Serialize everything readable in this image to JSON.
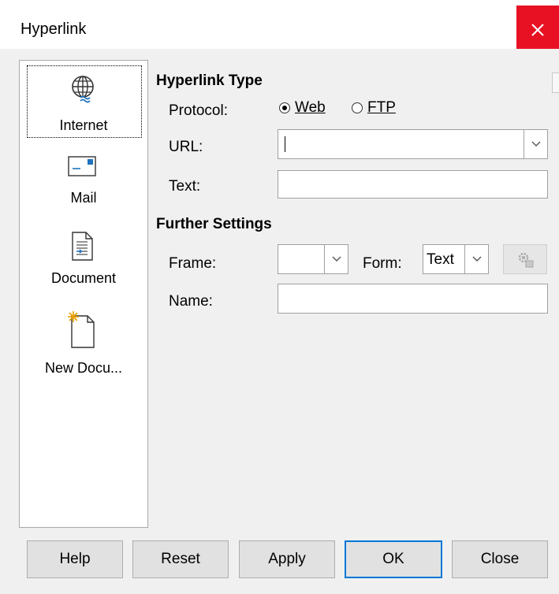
{
  "window": {
    "title": "Hyperlink"
  },
  "sidebar": {
    "items": [
      {
        "label": "Internet",
        "icon": "globe-link-icon",
        "selected": true
      },
      {
        "label": "Mail",
        "icon": "envelope-icon",
        "selected": false
      },
      {
        "label": "Document",
        "icon": "document-icon",
        "selected": false
      },
      {
        "label": "New Docu...",
        "icon": "new-document-icon",
        "selected": false
      }
    ]
  },
  "hyperlink_type": {
    "heading": "Hyperlink Type",
    "protocol_label": "Protocol:",
    "protocol_options": [
      {
        "label": "Web",
        "checked": true
      },
      {
        "label": "FTP",
        "checked": false
      }
    ],
    "url_label": "URL:",
    "url_value": "",
    "text_label": "Text:",
    "text_value": ""
  },
  "further_settings": {
    "heading": "Further Settings",
    "frame_label": "Frame:",
    "frame_value": "",
    "form_label": "Form:",
    "form_value": "Text",
    "name_label": "Name:",
    "name_value": ""
  },
  "buttons": {
    "help": "Help",
    "reset": "Reset",
    "apply": "Apply",
    "ok": "OK",
    "close": "Close"
  },
  "colors": {
    "close_bg": "#e81123",
    "default_border": "#0078d7"
  }
}
